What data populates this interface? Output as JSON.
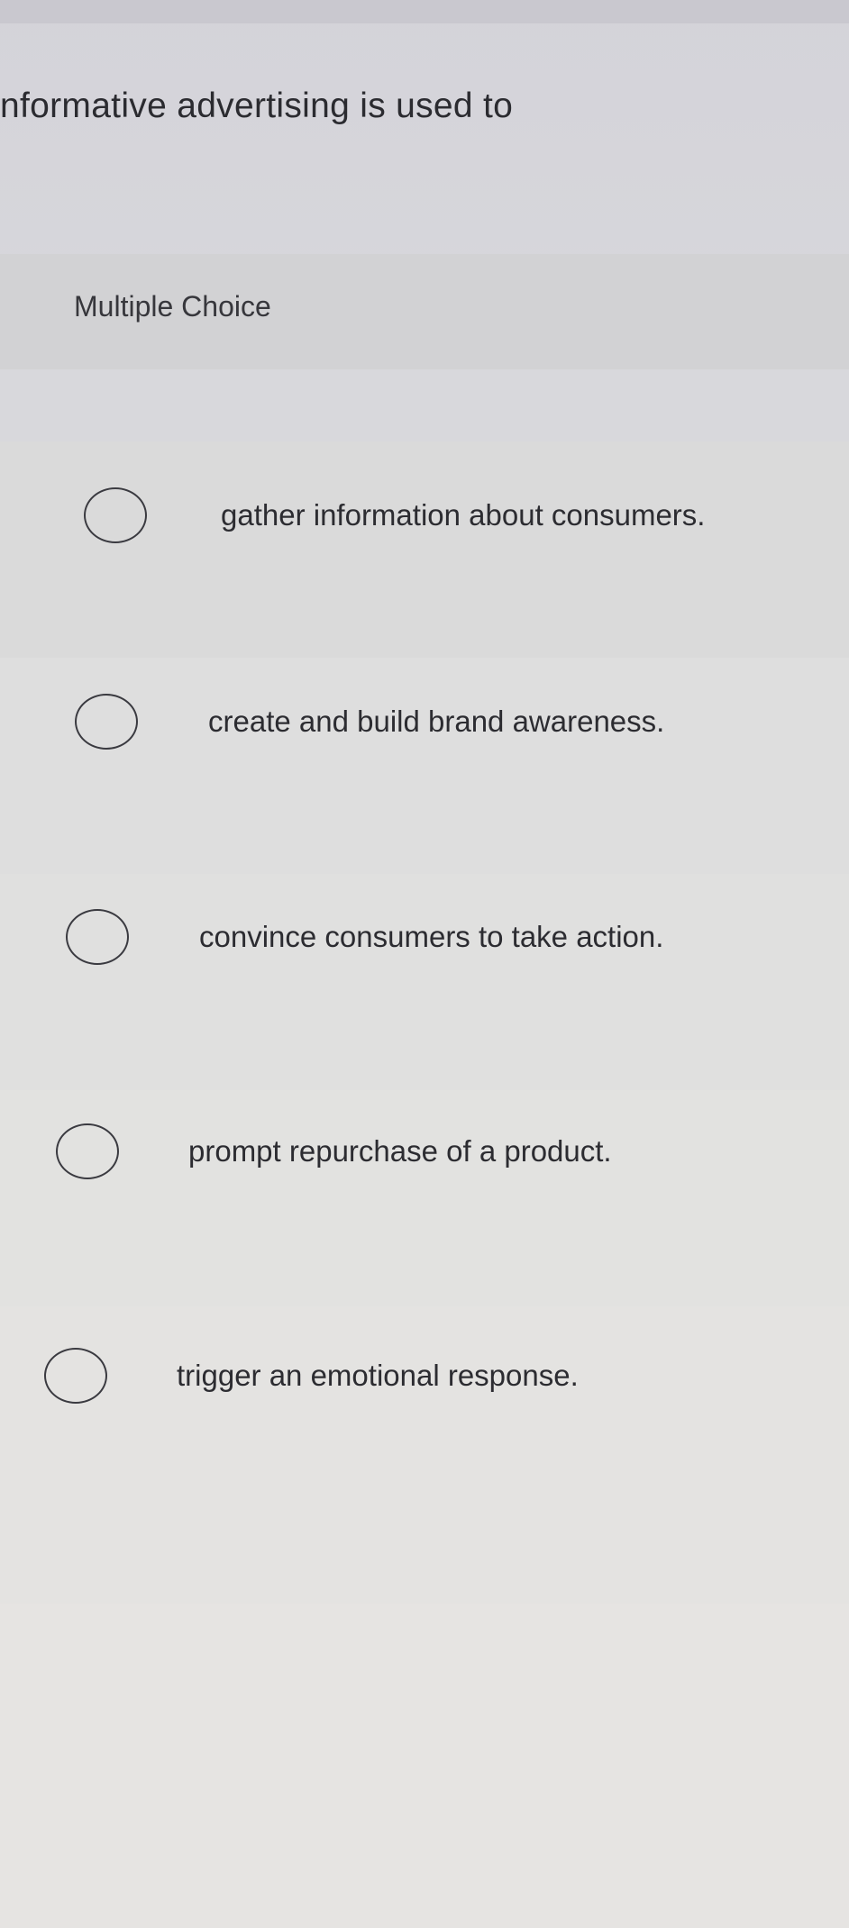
{
  "question": {
    "text": "nformative advertising is used to",
    "type_label": "Multiple Choice"
  },
  "choices": [
    {
      "label": "gather information about consumers.",
      "selected": false
    },
    {
      "label": "create and build brand awareness.",
      "selected": false
    },
    {
      "label": "convince consumers to take action.",
      "selected": false
    },
    {
      "label": "prompt repurchase of a product.",
      "selected": false
    },
    {
      "label": "trigger an emotional response.",
      "selected": false
    }
  ],
  "colors": {
    "text": "#2b2b30",
    "radio_border": "#3a3a40"
  }
}
